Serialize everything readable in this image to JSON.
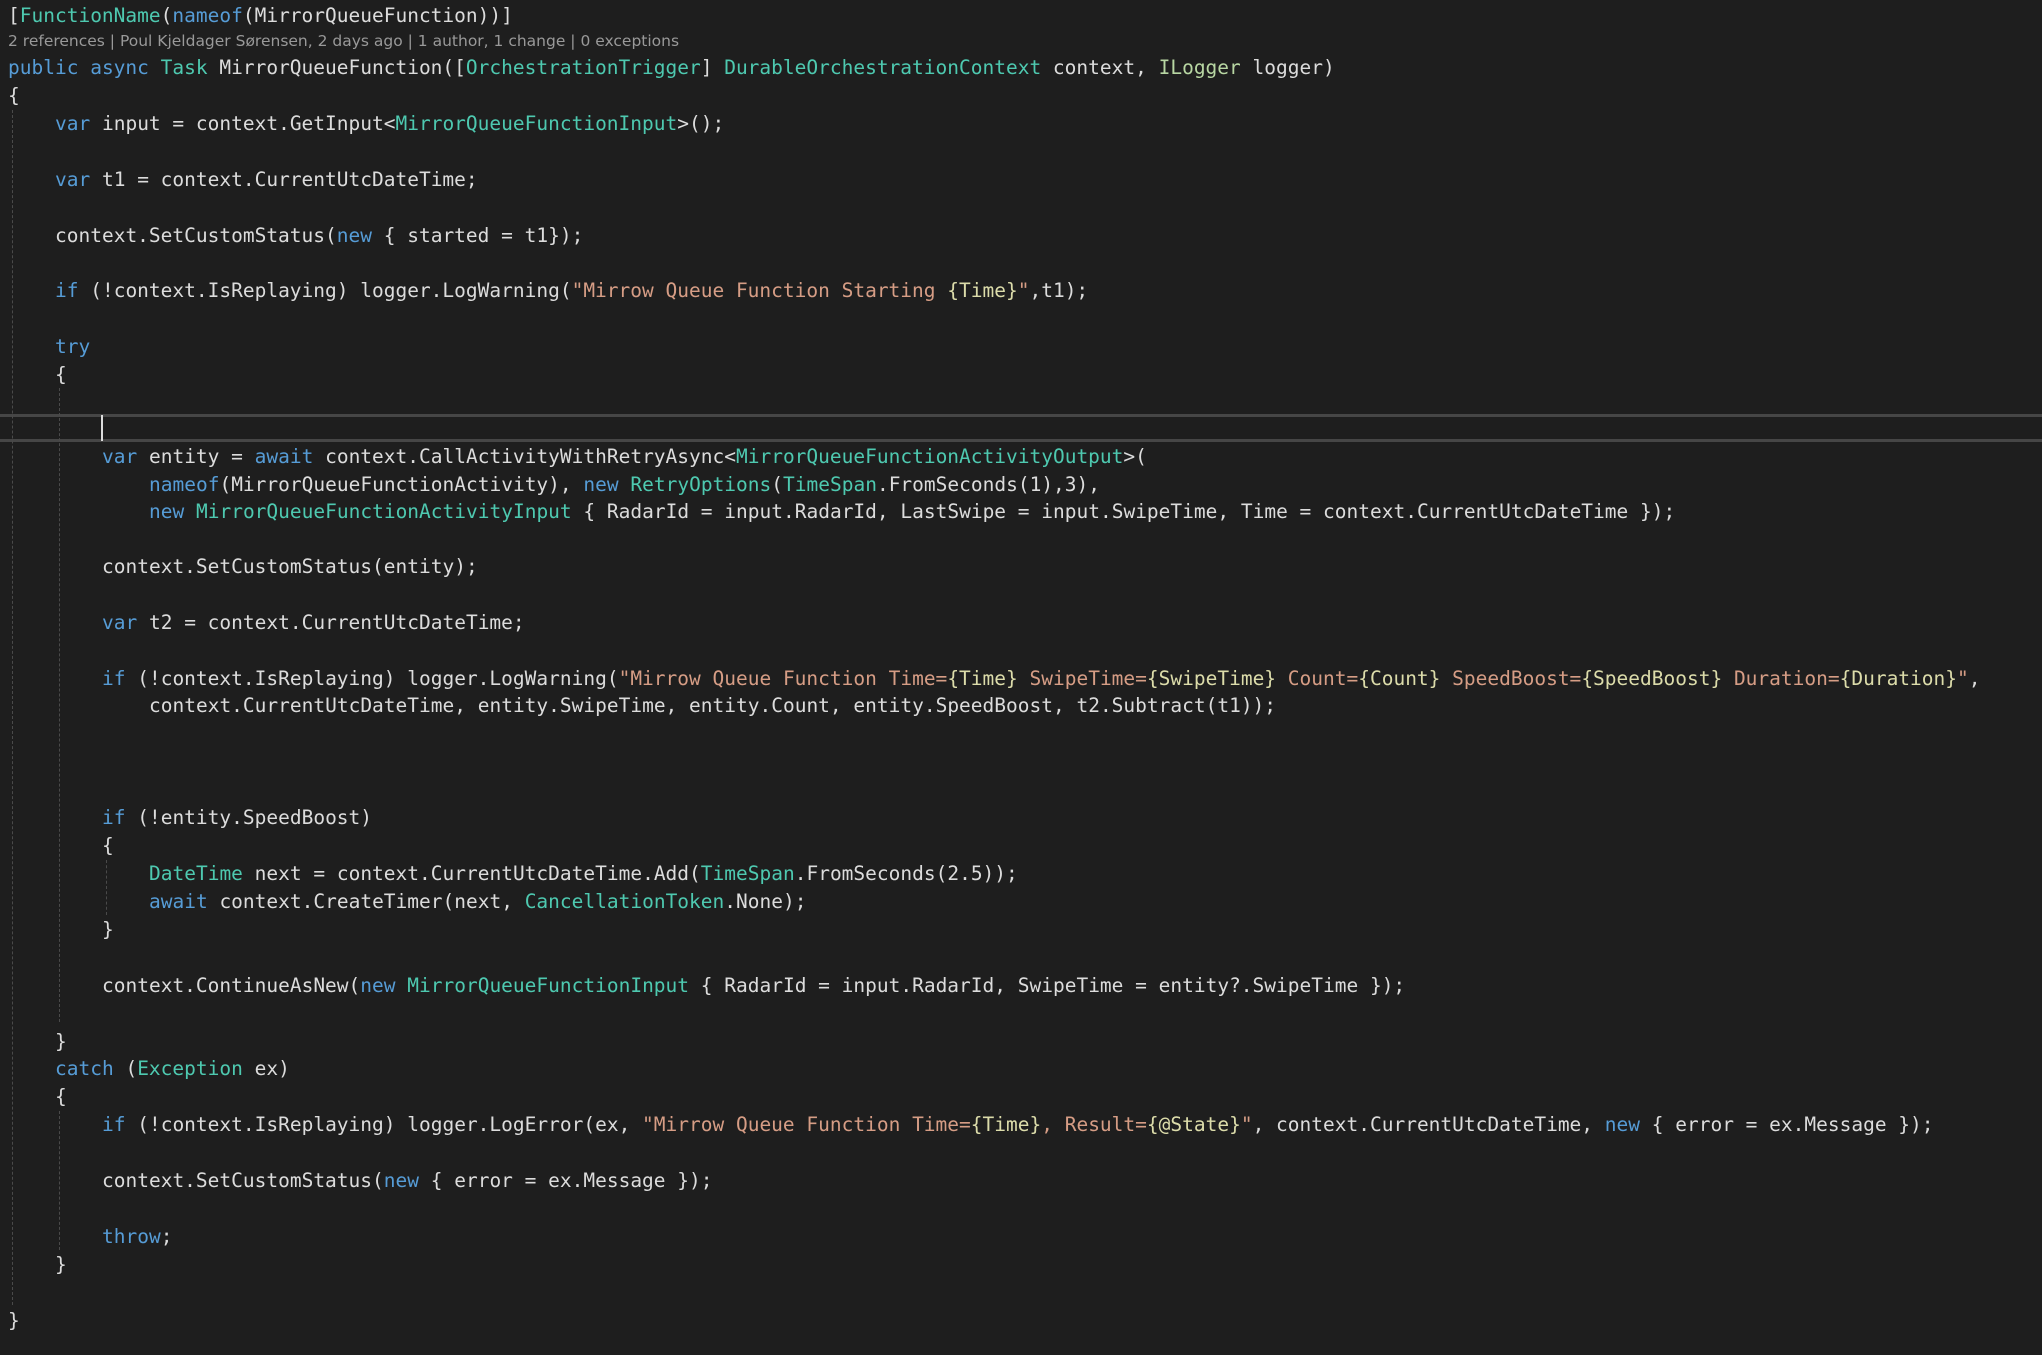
{
  "editor": {
    "codelens": "2 references | Poul Kjeldager Sørensen, 2 days ago | 1 author, 1 change | 0 exceptions",
    "lines": [
      {
        "indent": 0,
        "tokens": [
          [
            "plain",
            "["
          ],
          [
            "type",
            "FunctionName"
          ],
          [
            "plain",
            "("
          ],
          [
            "kw",
            "nameof"
          ],
          [
            "plain",
            "(MirrorQueueFunction))]"
          ]
        ]
      },
      {
        "indent": 0,
        "tokens": [
          [
            "kw",
            "public"
          ],
          [
            "plain",
            " "
          ],
          [
            "kw",
            "async"
          ],
          [
            "plain",
            " "
          ],
          [
            "type",
            "Task"
          ],
          [
            "plain",
            " MirrorQueueFunction(["
          ],
          [
            "type",
            "OrchestrationTrigger"
          ],
          [
            "plain",
            "] "
          ],
          [
            "type",
            "DurableOrchestrationContext"
          ],
          [
            "plain",
            " context, "
          ],
          [
            "iface",
            "ILogger"
          ],
          [
            "plain",
            " logger)"
          ]
        ]
      },
      {
        "indent": 0,
        "tokens": [
          [
            "plain",
            "{"
          ]
        ]
      },
      {
        "indent": 4,
        "tokens": [
          [
            "kw",
            "var"
          ],
          [
            "plain",
            " input = context.GetInput<"
          ],
          [
            "type",
            "MirrorQueueFunctionInput"
          ],
          [
            "plain",
            ">();"
          ]
        ]
      },
      {
        "indent": 4,
        "tokens": [
          [
            "kw",
            "var"
          ],
          [
            "plain",
            " t1 = context.CurrentUtcDateTime;"
          ]
        ]
      },
      {
        "indent": 4,
        "tokens": [
          [
            "plain",
            "context.SetCustomStatus("
          ],
          [
            "kw",
            "new"
          ],
          [
            "plain",
            " { started = t1});"
          ]
        ]
      },
      {
        "indent": 4,
        "tokens": [
          [
            "kw",
            "if"
          ],
          [
            "plain",
            " (!context.IsReplaying) logger.LogWarning("
          ],
          [
            "str",
            "\"Mirrow Queue Function Starting "
          ],
          [
            "fmt",
            "{Time}"
          ],
          [
            "str",
            "\""
          ],
          [
            "plain",
            ",t1);"
          ]
        ]
      },
      {
        "indent": 4,
        "tokens": [
          [
            "kw",
            "try"
          ]
        ]
      },
      {
        "indent": 4,
        "tokens": [
          [
            "plain",
            "{"
          ]
        ]
      },
      {
        "indent": 8,
        "tokens": [
          [
            "kw",
            "var"
          ],
          [
            "plain",
            " entity = "
          ],
          [
            "kw",
            "await"
          ],
          [
            "plain",
            " context.CallActivityWithRetryAsync<"
          ],
          [
            "type",
            "MirrorQueueFunctionActivityOutput"
          ],
          [
            "plain",
            ">("
          ]
        ]
      },
      {
        "indent": 12,
        "tokens": [
          [
            "kw",
            "nameof"
          ],
          [
            "plain",
            "(MirrorQueueFunctionActivity), "
          ],
          [
            "kw",
            "new"
          ],
          [
            "plain",
            " "
          ],
          [
            "type",
            "RetryOptions"
          ],
          [
            "plain",
            "("
          ],
          [
            "type",
            "TimeSpan"
          ],
          [
            "plain",
            ".FromSeconds(1),3),"
          ]
        ]
      },
      {
        "indent": 12,
        "tokens": [
          [
            "kw",
            "new"
          ],
          [
            "plain",
            " "
          ],
          [
            "type",
            "MirrorQueueFunctionActivityInput"
          ],
          [
            "plain",
            " { RadarId = input.RadarId, LastSwipe = input.SwipeTime, Time = context.CurrentUtcDateTime });"
          ]
        ]
      },
      {
        "indent": 8,
        "tokens": [
          [
            "plain",
            "context.SetCustomStatus(entity);"
          ]
        ]
      },
      {
        "indent": 8,
        "tokens": [
          [
            "kw",
            "var"
          ],
          [
            "plain",
            " t2 = context.CurrentUtcDateTime;"
          ]
        ]
      },
      {
        "indent": 8,
        "tokens": [
          [
            "kw",
            "if"
          ],
          [
            "plain",
            " (!context.IsReplaying) logger.LogWarning("
          ],
          [
            "str",
            "\"Mirrow Queue Function Time="
          ],
          [
            "fmt",
            "{Time}"
          ],
          [
            "str",
            " SwipeTime="
          ],
          [
            "fmt",
            "{SwipeTime}"
          ],
          [
            "str",
            " Count="
          ],
          [
            "fmt",
            "{Count}"
          ],
          [
            "str",
            " SpeedBoost="
          ],
          [
            "fmt",
            "{SpeedBoost}"
          ],
          [
            "str",
            " Duration="
          ],
          [
            "fmt",
            "{Duration}"
          ],
          [
            "str",
            "\""
          ],
          [
            "plain",
            ","
          ]
        ]
      },
      {
        "indent": 12,
        "tokens": [
          [
            "plain",
            "context.CurrentUtcDateTime, entity.SwipeTime, entity.Count, entity.SpeedBoost, t2.Subtract(t1));"
          ]
        ]
      },
      {
        "indent": 8,
        "tokens": [
          [
            "kw",
            "if"
          ],
          [
            "plain",
            " (!entity.SpeedBoost)"
          ]
        ]
      },
      {
        "indent": 8,
        "tokens": [
          [
            "plain",
            "{"
          ]
        ]
      },
      {
        "indent": 12,
        "tokens": [
          [
            "type",
            "DateTime"
          ],
          [
            "plain",
            " next = context.CurrentUtcDateTime.Add("
          ],
          [
            "type",
            "TimeSpan"
          ],
          [
            "plain",
            ".FromSeconds(2.5));"
          ]
        ]
      },
      {
        "indent": 12,
        "tokens": [
          [
            "kw",
            "await"
          ],
          [
            "plain",
            " context.CreateTimer(next, "
          ],
          [
            "type",
            "CancellationToken"
          ],
          [
            "plain",
            ".None);"
          ]
        ]
      },
      {
        "indent": 8,
        "tokens": [
          [
            "plain",
            "}"
          ]
        ]
      },
      {
        "indent": 8,
        "tokens": [
          [
            "plain",
            "context.ContinueAsNew("
          ],
          [
            "kw",
            "new"
          ],
          [
            "plain",
            " "
          ],
          [
            "type",
            "MirrorQueueFunctionInput"
          ],
          [
            "plain",
            " { RadarId = input.RadarId, SwipeTime = entity?.SwipeTime });"
          ]
        ]
      },
      {
        "indent": 4,
        "tokens": [
          [
            "plain",
            "}"
          ]
        ]
      },
      {
        "indent": 4,
        "tokens": [
          [
            "kw",
            "catch"
          ],
          [
            "plain",
            " ("
          ],
          [
            "type",
            "Exception"
          ],
          [
            "plain",
            " ex)"
          ]
        ]
      },
      {
        "indent": 4,
        "tokens": [
          [
            "plain",
            "{"
          ]
        ]
      },
      {
        "indent": 8,
        "tokens": [
          [
            "kw",
            "if"
          ],
          [
            "plain",
            " (!context.IsReplaying) logger.LogError(ex, "
          ],
          [
            "str",
            "\"Mirrow Queue Function Time="
          ],
          [
            "fmt",
            "{Time}"
          ],
          [
            "str",
            ", Result="
          ],
          [
            "fmt",
            "{@State}"
          ],
          [
            "str",
            "\""
          ],
          [
            "plain",
            ", context.CurrentUtcDateTime, "
          ],
          [
            "kw",
            "new"
          ],
          [
            "plain",
            " { error = ex.Message });"
          ]
        ]
      },
      {
        "indent": 8,
        "tokens": [
          [
            "plain",
            "context.SetCustomStatus("
          ],
          [
            "kw",
            "new"
          ],
          [
            "plain",
            " { error = ex.Message });"
          ]
        ]
      },
      {
        "indent": 8,
        "tokens": [
          [
            "kw",
            "throw"
          ],
          [
            "plain",
            ";"
          ]
        ]
      },
      {
        "indent": 4,
        "tokens": [
          [
            "plain",
            "}"
          ]
        ]
      },
      {
        "indent": 0,
        "tokens": [
          [
            "plain",
            "}"
          ]
        ]
      }
    ]
  },
  "colors": {
    "background": "#1e1e1e",
    "plain": "#dcdcdc",
    "keyword": "#569cd6",
    "type": "#4ec9b0",
    "interface": "#b8d7a3",
    "string": "#d69d85",
    "format_placeholder": "#dcdcaa",
    "codelens": "#999999"
  }
}
